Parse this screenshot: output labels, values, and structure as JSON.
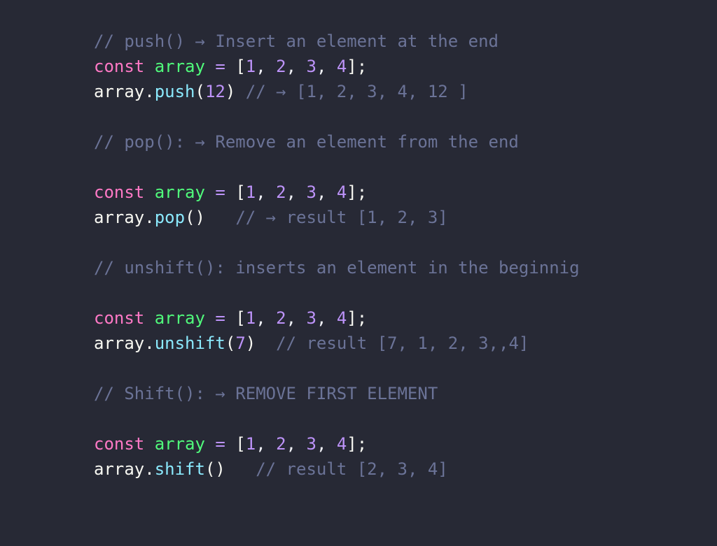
{
  "code": {
    "sections": [
      {
        "comment": "// push() → Insert an element at the end",
        "decl": {
          "keyword": "const",
          "identifier": "array",
          "operator": "=",
          "open_bracket": "[",
          "values": [
            "1",
            "2",
            "3",
            "4"
          ],
          "close": "];"
        },
        "call": {
          "object": "array",
          "dot": ".",
          "method": "push",
          "paren_open": "(",
          "arg": "12",
          "paren_close": ")",
          "trailing_comment": " // → [1, 2, 3, 4, 12 ]"
        }
      },
      {
        "comment": "// pop(): → Remove an element from the end",
        "decl": {
          "keyword": "const",
          "identifier": "array",
          "operator": "=",
          "open_bracket": "[",
          "values": [
            "1",
            "2",
            "3",
            "4"
          ],
          "close": "];"
        },
        "call": {
          "object": "array",
          "dot": ".",
          "method": "pop",
          "paren_open": "(",
          "arg": "",
          "paren_close": ")",
          "trailing_comment": "   // → result [1, 2, 3]"
        }
      },
      {
        "comment": "// unshift(): inserts an element in the beginnig",
        "decl": {
          "keyword": "const",
          "identifier": "array",
          "operator": "=",
          "open_bracket": "[",
          "values": [
            "1",
            "2",
            "3",
            "4"
          ],
          "close": "];"
        },
        "call": {
          "object": "array",
          "dot": ".",
          "method": "unshift",
          "paren_open": "(",
          "arg": "7",
          "paren_close": ")",
          "trailing_comment": "  // result [7, 1, 2, 3,,4]"
        }
      },
      {
        "comment": "// Shift(): → REMOVE FIRST ELEMENT",
        "decl": {
          "keyword": "const",
          "identifier": "array",
          "operator": "=",
          "open_bracket": "[",
          "values": [
            "1",
            "2",
            "3",
            "4"
          ],
          "close": "];"
        },
        "call": {
          "object": "array",
          "dot": ".",
          "method": "shift",
          "paren_open": "(",
          "arg": "",
          "paren_close": ")",
          "trailing_comment": "   // result [2, 3, 4]"
        }
      }
    ],
    "colors": {
      "background": "#272935",
      "comment": "#6b7397",
      "keyword": "#ff79c6",
      "identifier": "#50fa7b",
      "number": "#bd93f9",
      "method": "#8be9fd",
      "text": "#f8f8f2"
    }
  }
}
